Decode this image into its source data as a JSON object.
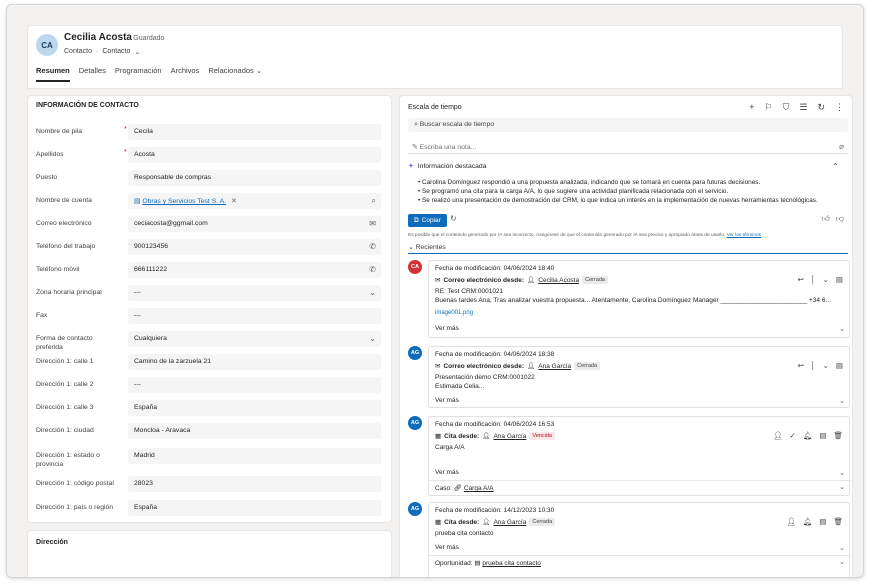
{
  "header": {
    "avatar_initials": "CA",
    "name": "Cecilia Acosta",
    "status": "· Guardado",
    "entity": "Contacto",
    "sep": "·",
    "form": "Contacto",
    "form_chevron": "⌄",
    "tabs": [
      "Resumen",
      "Detalles",
      "Programación",
      "Archivos",
      "Relacionados"
    ],
    "tabs_more": "⌄"
  },
  "contact": {
    "section_title": "INFORMACIÓN DE CONTACTO",
    "fields": [
      {
        "label": "Nombre de pila",
        "required": "*",
        "value": "Cecila"
      },
      {
        "label": "Apellidos",
        "required": "*",
        "value": "Acosta"
      },
      {
        "label": "Puesto",
        "required": "",
        "value": "Responsable de compras"
      },
      {
        "label": "Nombre de cuenta",
        "required": "",
        "value": "Obras y Servicios Test S. A."
      },
      {
        "label": "Correo electrónico",
        "required": "",
        "value": "ceciacosta@ggmail.com"
      },
      {
        "label": "Teléfono del trabajo",
        "required": "",
        "value": "900123456"
      },
      {
        "label": "Teléfono móvil",
        "required": "",
        "value": "666111222"
      },
      {
        "label": "Zona horaria principal",
        "required": "",
        "value": "---"
      },
      {
        "label": "Fax",
        "required": "",
        "value": "---"
      },
      {
        "label": "Forma de contacto preferida",
        "required": "",
        "value": "Cualquiera"
      },
      {
        "label": "Dirección 1: calle 1",
        "required": "",
        "value": "Camino de la zarzuela 21"
      },
      {
        "label": "Dirección 1: calle 2",
        "required": "",
        "value": "---"
      },
      {
        "label": "Dirección 1: calle 3",
        "required": "",
        "value": "España"
      },
      {
        "label": "Dirección 1: ciudad",
        "required": "",
        "value": "Moncloa - Aravaca"
      },
      {
        "label": "Dirección 1: estado o provincia",
        "required": "",
        "value": "Madrid"
      },
      {
        "label": "Dirección 1: código postal",
        "required": "",
        "value": "28023"
      },
      {
        "label": "Dirección 1: país o región",
        "required": "",
        "value": "España"
      }
    ],
    "icons": {
      "search": "⌕",
      "mail": "✉",
      "phone": "✆",
      "chevron": "⌄",
      "account": "▤",
      "clear": "✕"
    },
    "address_title": "Dirección"
  },
  "timeline": {
    "title": "Escala de tiempo",
    "tools": [
      "+",
      "⚐",
      "⛉",
      "☰",
      "↻",
      "⋮"
    ],
    "search_icon": "⌕",
    "search_placeholder": "Buscar escala de tiempo",
    "note_icon": "✎",
    "note_placeholder": "Escriba una nota...",
    "clip_icon": "⌀",
    "highlight_icon": "✦",
    "highlight_title": "Información destacada",
    "highlight_caret": "⌃",
    "highlights": [
      "Carolina Domínguez respondió a una propuesta analizada, indicando que se tomará en cuenta para futuras decisiones.",
      "Se programó una cita para la carga A/A, lo que sugiere una actividad planificada relacionada con el servicio.",
      "Se realizó una presentación de demostración del CRM, lo que indica un interés en la implementación de nuevas herramientas tecnológicas."
    ],
    "copy_icon": "⧉",
    "copy_label": "Copiar",
    "refresh_icon": "↻",
    "thumb_up": "👍︎",
    "thumb_down": "👎︎",
    "disclaimer": "Es posible que el contenido generado por IA sea incorrecto. Asegúrese de que el contenido generado por IA sea preciso y apropiado antes de usarlo.",
    "terms": "Ver los términos",
    "recent_label": "Recientes",
    "recent_chevron": "⌄",
    "more_label": "Ver más",
    "chev": "⌄",
    "items": [
      {
        "avatar": "CA",
        "avatar_color": "#d13438",
        "date": "Fecha de modificación: 04/06/2024 18:40",
        "type_icon": "✉",
        "type": "Correo electrónico desde:",
        "person_icon": "👤︎",
        "person": "Cecilia Acosta",
        "badge": "Cerrada",
        "body1": "RE: Test CRM:0001021",
        "body2": "Buenas tardes Ana,   Tras analizar vuestra propuesta...     Atentamente,   Carolina Domínguez Manager ________________________     +34 6...",
        "attachment": "image001.png",
        "actions": [
          "↩",
          "│",
          "⌄",
          "▤"
        ]
      },
      {
        "avatar": "AG",
        "avatar_color": "#0f6cbd",
        "date": "Fecha de modificación: 04/06/2024 18:38",
        "type_icon": "✉",
        "type": "Correo electrónico desde:",
        "person_icon": "👤︎",
        "person": "Ana García",
        "badge": "Cerrada",
        "body1": "Presentación demo CRM:0001022",
        "body2": "Estimada Celia...",
        "actions": [
          "↩",
          "│",
          "⌄",
          "▤"
        ]
      },
      {
        "avatar": "AG",
        "avatar_color": "#0f6cbd",
        "date": "Fecha de modificación: 04/06/2024 16:53",
        "type_icon": "▦",
        "type": "Cita desde:",
        "person_icon": "👤︎",
        "person": "Ana García",
        "badge": "Vencida",
        "body1": "Carga A/A",
        "foot_label": "Caso:",
        "foot_icon": "🔗︎",
        "foot_link": "Carga A/A",
        "actions": [
          "👤︎",
          "✓",
          "🔔︎",
          "▤",
          "🗑︎"
        ]
      },
      {
        "avatar": "AG",
        "avatar_color": "#0f6cbd",
        "date": "Fecha de modificación: 14/12/2023 10:30",
        "type_icon": "▦",
        "type": "Cita desde:",
        "person_icon": "👤︎",
        "person": "Ana García",
        "badge": "Cerrada",
        "body1": "prueba cita contacto",
        "foot_label": "Oportunidad:",
        "foot_icon": "▤",
        "foot_link": "prueba cita contacto",
        "actions": [
          "👤︎",
          "🔔︎",
          "▤",
          "🗑︎"
        ]
      }
    ]
  }
}
